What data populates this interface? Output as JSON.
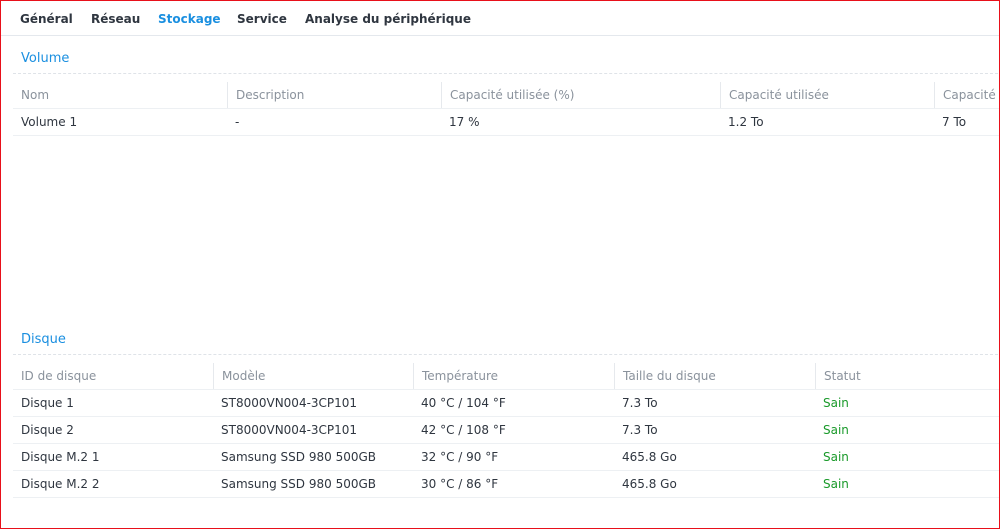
{
  "tabs": [
    {
      "label": "Général"
    },
    {
      "label": "Réseau"
    },
    {
      "label": "Stockage",
      "active": true
    },
    {
      "label": "Service"
    },
    {
      "label": "Analyse du périphérique"
    }
  ],
  "volume": {
    "title": "Volume",
    "columns": [
      "Nom",
      "Description",
      "Capacité utilisée (%)",
      "Capacité utilisée",
      "Capacité t"
    ],
    "rows": [
      [
        "Volume 1",
        "-",
        "17 %",
        "1.2 To",
        "7 To"
      ]
    ]
  },
  "disk": {
    "title": "Disque",
    "columns": [
      "ID de disque",
      "Modèle",
      "Température",
      "Taille du disque",
      "Statut"
    ],
    "rows": [
      [
        "Disque 1",
        "ST8000VN004-3CP101",
        "40 °C / 104 °F",
        "7.3 To",
        "Sain"
      ],
      [
        "Disque 2",
        "ST8000VN004-3CP101",
        "42 °C / 108 °F",
        "7.3 To",
        "Sain"
      ],
      [
        "Disque M.2 1",
        "Samsung SSD 980 500GB",
        "32 °C / 90 °F",
        "465.8 Go",
        "Sain"
      ],
      [
        "Disque M.2 2",
        "Samsung SSD 980 500GB",
        "30 °C / 86 °F",
        "465.8 Go",
        "Sain"
      ]
    ]
  },
  "colors": {
    "accent": "#1a8fe0",
    "status_ok": "#1a9a2a",
    "frame_border": "#e8101a"
  }
}
